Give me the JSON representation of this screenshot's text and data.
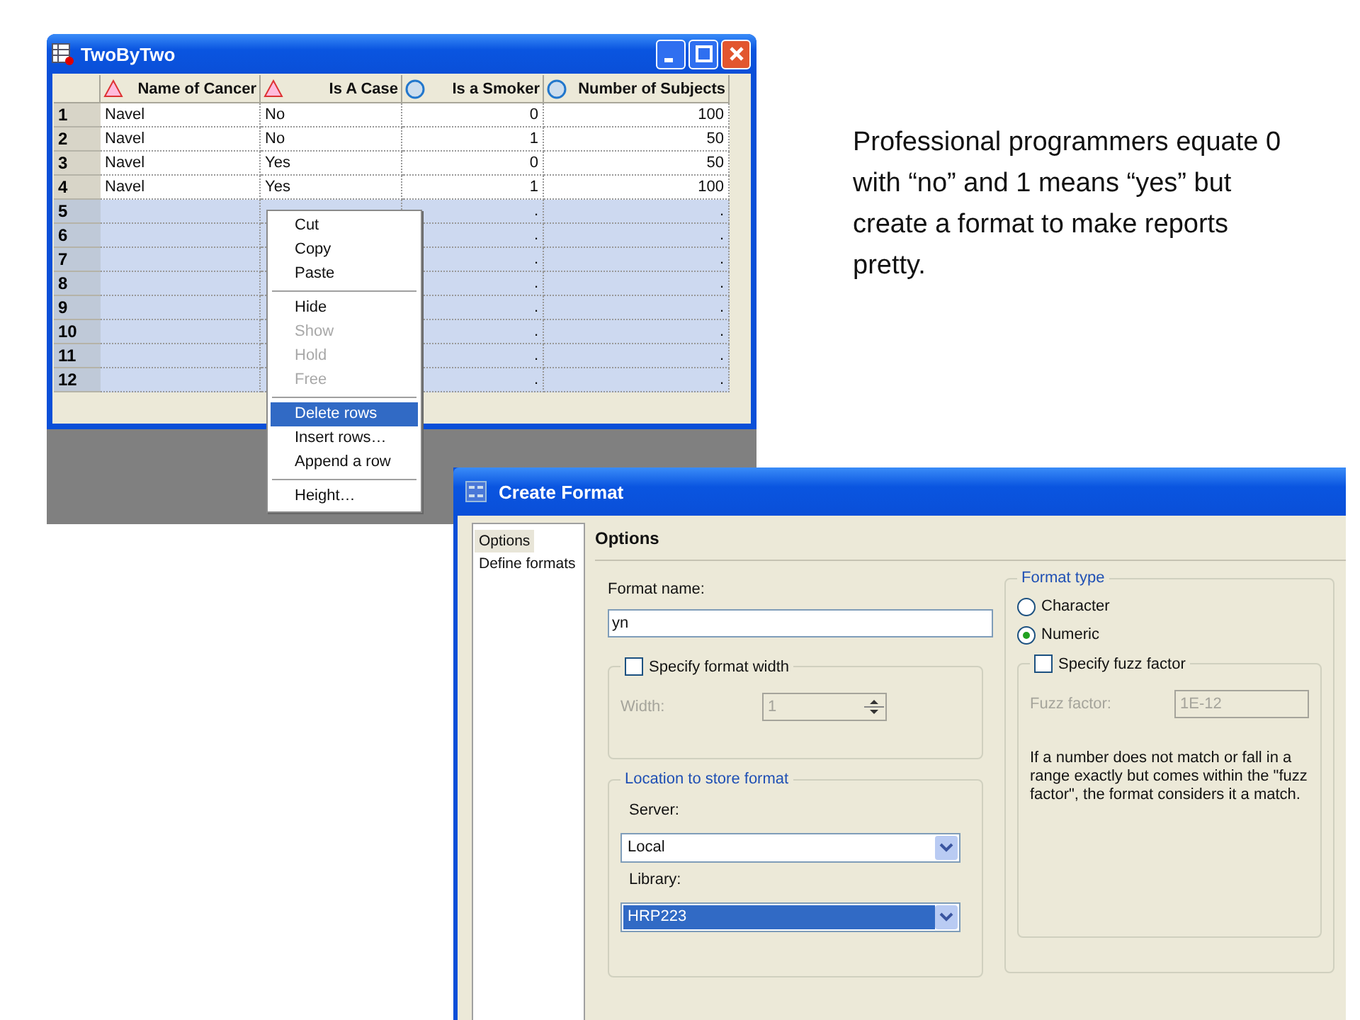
{
  "note": "Professional programmers equate 0 with “no” and 1 means “yes” but create a format to make reports pretty.",
  "table_window": {
    "title": "TwoByTwo",
    "columns": [
      {
        "label": "Name of Cancer",
        "kind": "character"
      },
      {
        "label": "Is A Case",
        "kind": "character"
      },
      {
        "label": "Is a Smoker",
        "kind": "numeric"
      },
      {
        "label": "Number of Subjects",
        "kind": "numeric"
      }
    ],
    "rows": [
      {
        "number": "1",
        "selected": false,
        "cells": [
          "Navel",
          "No",
          "0",
          "100"
        ]
      },
      {
        "number": "2",
        "selected": false,
        "cells": [
          "Navel",
          "No",
          "1",
          "50"
        ]
      },
      {
        "number": "3",
        "selected": false,
        "cells": [
          "Navel",
          "Yes",
          "0",
          "50"
        ]
      },
      {
        "number": "4",
        "selected": false,
        "cells": [
          "Navel",
          "Yes",
          "1",
          "100"
        ]
      },
      {
        "number": "5",
        "selected": true,
        "cells": [
          null,
          null,
          ".",
          "."
        ]
      },
      {
        "number": "6",
        "selected": true,
        "cells": [
          null,
          null,
          ".",
          "."
        ]
      },
      {
        "number": "7",
        "selected": true,
        "cells": [
          null,
          null,
          ".",
          "."
        ]
      },
      {
        "number": "8",
        "selected": true,
        "cells": [
          null,
          null,
          ".",
          "."
        ]
      },
      {
        "number": "9",
        "selected": true,
        "cells": [
          null,
          null,
          ".",
          "."
        ]
      },
      {
        "number": "10",
        "selected": true,
        "cells": [
          null,
          null,
          ".",
          "."
        ]
      },
      {
        "number": "11",
        "selected": true,
        "cells": [
          null,
          null,
          ".",
          "."
        ]
      },
      {
        "number": "12",
        "selected": true,
        "cells": [
          null,
          null,
          ".",
          "."
        ]
      }
    ]
  },
  "context_menu": [
    {
      "kind": "item",
      "label": "Cut",
      "disabled": false,
      "selected": false
    },
    {
      "kind": "item",
      "label": "Copy",
      "disabled": false,
      "selected": false
    },
    {
      "kind": "item",
      "label": "Paste",
      "disabled": false,
      "selected": false
    },
    {
      "kind": "separator"
    },
    {
      "kind": "item",
      "label": "Hide",
      "disabled": false,
      "selected": false
    },
    {
      "kind": "item",
      "label": "Show",
      "disabled": true,
      "selected": false
    },
    {
      "kind": "item",
      "label": "Hold",
      "disabled": true,
      "selected": false
    },
    {
      "kind": "item",
      "label": "Free",
      "disabled": true,
      "selected": false
    },
    {
      "kind": "separator"
    },
    {
      "kind": "item",
      "label": "Delete rows",
      "disabled": false,
      "selected": true
    },
    {
      "kind": "item",
      "label": "Insert rows…",
      "disabled": false,
      "selected": false
    },
    {
      "kind": "item",
      "label": "Append a row",
      "disabled": false,
      "selected": false
    },
    {
      "kind": "separator"
    },
    {
      "kind": "item",
      "label": "Height…",
      "disabled": false,
      "selected": false
    }
  ],
  "create_format": {
    "title": "Create Format",
    "nav": [
      {
        "label": "Options",
        "selected": true
      },
      {
        "label": "Define formats",
        "selected": false
      }
    ],
    "heading": "Options",
    "format_name": {
      "label": "Format name:",
      "value": "yn"
    },
    "format_width": {
      "label": "Specify format width",
      "checked": false,
      "width_label": "Width:",
      "width_value": "1",
      "disabled": true
    },
    "location": {
      "legend": "Location to store format",
      "server_label": "Server:",
      "server": "Local",
      "library_label": "Library:",
      "library": "HRP223",
      "library_focused": true
    },
    "format_type": {
      "legend": "Format type",
      "options": [
        {
          "label": "Character",
          "selected": false
        },
        {
          "label": "Numeric",
          "selected": true
        }
      ]
    },
    "fuzz": {
      "label": "Specify fuzz factor",
      "checked": false,
      "factor_label": "Fuzz factor:",
      "factor_value": "1E-12",
      "disabled": true,
      "help": "If a number does not match or fall in a range exactly but comes within the \"fuzz factor\", the format considers it a match."
    }
  }
}
